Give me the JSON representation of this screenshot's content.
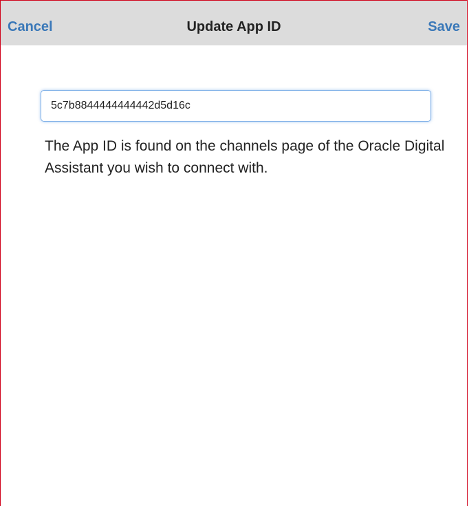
{
  "navbar": {
    "cancel_label": "Cancel",
    "title": "Update App ID",
    "save_label": "Save"
  },
  "form": {
    "app_id_value": "5c7b8844444444442d5d16c",
    "help_text": "The App ID is found on the channels page of the Oracle Digital Assistant you wish to connect with."
  },
  "colors": {
    "accent": "#3a78b8",
    "navbar_background": "#dcdcdc",
    "frame_border": "#d0021b"
  }
}
